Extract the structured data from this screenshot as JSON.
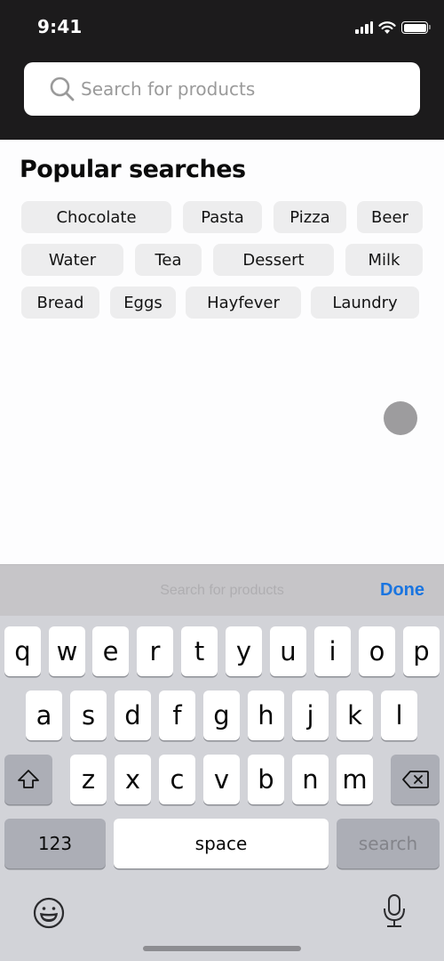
{
  "status_bar": {
    "time": "9:41",
    "icons": [
      "cellular-signal-icon",
      "wifi-icon",
      "battery-icon"
    ]
  },
  "search": {
    "placeholder": "Search for products",
    "value": "",
    "icon": "search-icon"
  },
  "popular": {
    "title": "Popular searches",
    "chips": [
      {
        "label": "Chocolate"
      },
      {
        "label": "Pasta"
      },
      {
        "label": "Pizza"
      },
      {
        "label": "Beer"
      },
      {
        "label": "Water"
      },
      {
        "label": "Tea"
      },
      {
        "label": "Dessert"
      },
      {
        "label": "Milk"
      },
      {
        "label": "Bread"
      },
      {
        "label": "Eggs"
      },
      {
        "label": "Hayfever"
      },
      {
        "label": "Laundry"
      }
    ]
  },
  "keyboard_accessory": {
    "hint": "Search for products",
    "done_label": "Done",
    "done_color": "#1a75e0"
  },
  "keyboard": {
    "row1": [
      "q",
      "w",
      "e",
      "r",
      "t",
      "y",
      "u",
      "i",
      "o",
      "p"
    ],
    "row2": [
      "a",
      "s",
      "d",
      "f",
      "g",
      "h",
      "j",
      "k",
      "l"
    ],
    "row3": [
      "z",
      "x",
      "c",
      "v",
      "b",
      "n",
      "m"
    ],
    "numbers_label": "123",
    "space_label": "space",
    "return_label": "search",
    "icons": [
      "shift-icon",
      "delete-icon",
      "emoji-icon",
      "microphone-icon"
    ]
  }
}
